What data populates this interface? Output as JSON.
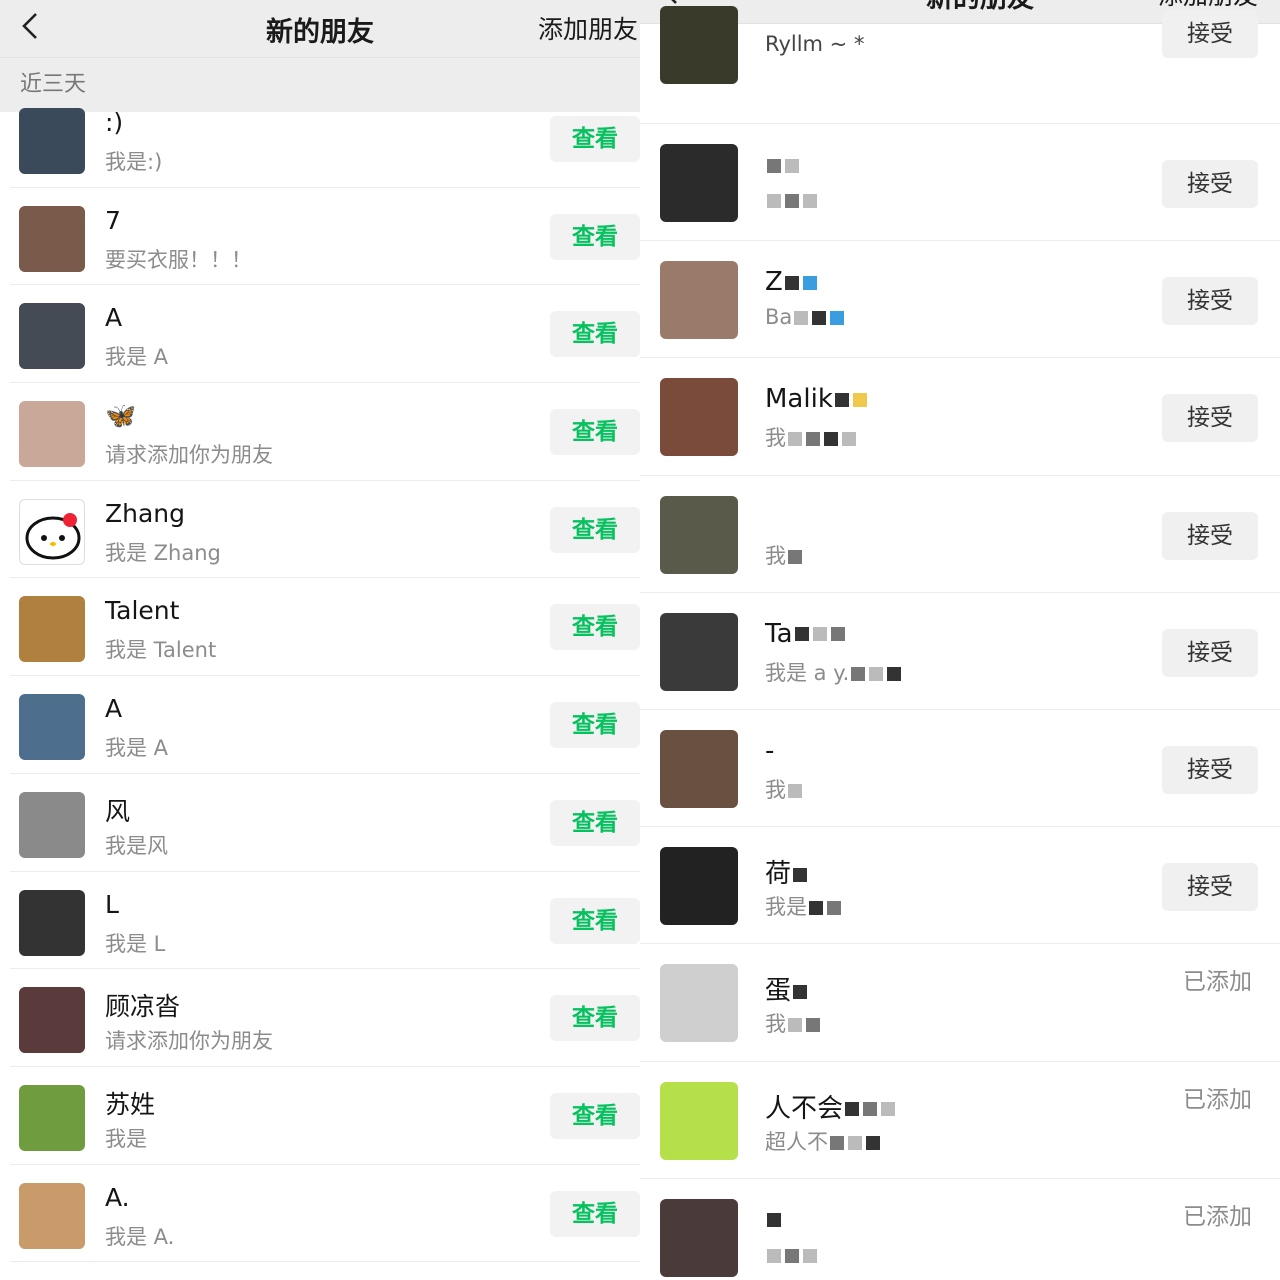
{
  "left": {
    "nav": {
      "title": "新的朋友",
      "action": "添加朋友"
    },
    "section": "近三天",
    "button_label": "查看",
    "rows": [
      {
        "name": ":)",
        "sub": "我是:)",
        "color": "#3b4a5a"
      },
      {
        "name": "7",
        "sub": "要买衣服！！！",
        "color": "#7a5a4a"
      },
      {
        "name": "A",
        "sub": "我是 A",
        "color": "#444b55"
      },
      {
        "name": "🦋",
        "sub": "请求添加你为朋友",
        "color": "#c9a89a"
      },
      {
        "name": "Zhang",
        "sub": "我是 Zhang",
        "color": "#ffffff"
      },
      {
        "name": "Talent",
        "sub": "我是 Talent",
        "color": "#b0803f"
      },
      {
        "name": "A",
        "sub": "我是 A",
        "color": "#4d6e8c"
      },
      {
        "name": "风",
        "sub": "我是风",
        "color": "#8a8a8a"
      },
      {
        "name": "L",
        "sub": "我是 L",
        "color": "#333333"
      },
      {
        "name": "顾凉沓",
        "sub": "请求添加你为朋友",
        "color": "#5a3a3a"
      },
      {
        "name": "苏姓",
        "sub": "我是",
        "color": "#6e9c3f"
      },
      {
        "name": "A.",
        "sub": "我是 A.",
        "color": "#c99a6a"
      }
    ]
  },
  "right": {
    "nav": {
      "title": "新的朋友",
      "action": "添加朋友"
    },
    "accept_label": "接受",
    "added_label": "已添加",
    "first_sub": "Ryllm ~ *",
    "rows": [
      {
        "name": "",
        "sub": "",
        "state": "accept",
        "color": "#2b2b2b"
      },
      {
        "name": "Z",
        "sub": "Ba",
        "state": "accept",
        "color": "#9a7a6a"
      },
      {
        "name": "Malik",
        "sub": "我",
        "state": "accept",
        "color": "#7a4a3a"
      },
      {
        "name": "",
        "sub": "我",
        "state": "accept",
        "color": "#5a5a4a"
      },
      {
        "name": "Ta",
        "sub": "我是 a y.",
        "state": "accept",
        "color": "#3a3a3a"
      },
      {
        "name": "-",
        "sub": "我",
        "state": "accept",
        "color": "#6a5040"
      },
      {
        "name": "荷",
        "sub": "我是",
        "state": "accept",
        "color": "#222222"
      },
      {
        "name": "蛋",
        "sub": "我",
        "state": "added",
        "color": "#cfcfcf"
      },
      {
        "name": "人不会",
        "sub": "超人不",
        "state": "added",
        "color": "#b6e04a"
      },
      {
        "name": "",
        "sub": "",
        "state": "added",
        "color": "#4a3a3a"
      }
    ]
  }
}
